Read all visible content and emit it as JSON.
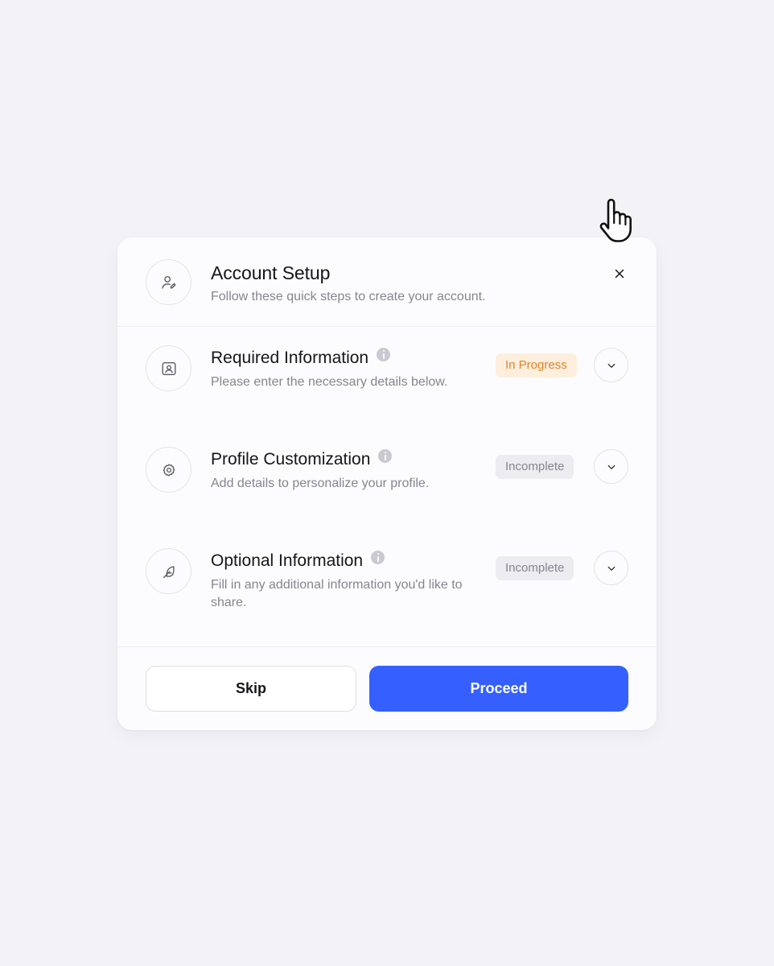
{
  "dialog": {
    "title": "Account Setup",
    "subtitle": "Follow these quick steps to create your account.",
    "header_icon": "user-edit-icon",
    "close_icon": "close-icon"
  },
  "steps": [
    {
      "icon": "id-card-icon",
      "title": "Required Information",
      "description": "Please enter the necessary details below.",
      "status": "In Progress",
      "status_color": "#e08428"
    },
    {
      "icon": "gear-badge-icon",
      "title": "Profile Customization",
      "description": "Add details to personalize your profile.",
      "status": "Incomplete",
      "status_color": "#85858f"
    },
    {
      "icon": "feather-icon",
      "title": "Optional Information",
      "description": "Fill in any additional information you'd like to share.",
      "status": "Incomplete",
      "status_color": "#85858f"
    }
  ],
  "footer": {
    "skip_label": "Skip",
    "proceed_label": "Proceed"
  },
  "colors": {
    "accent": "#3560ff",
    "in_progress_bg": "#fdeedd",
    "incomplete_bg": "#ececf1",
    "background": "#f2f2f7"
  }
}
